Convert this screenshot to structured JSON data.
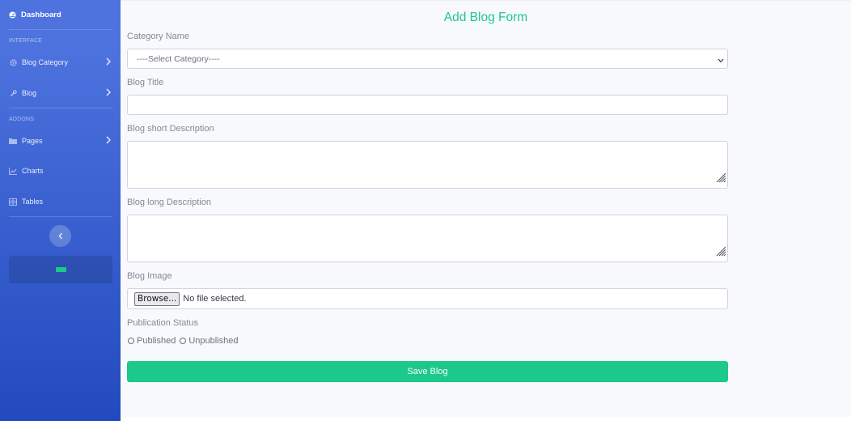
{
  "sidebar": {
    "brand_label": "Dashboard",
    "headings": [
      "INTERFACE",
      "ADDONS"
    ],
    "items": [
      {
        "label": "Blog Category",
        "icon": "gear-icon"
      },
      {
        "label": "Blog",
        "icon": "wrench-icon"
      },
      {
        "label": "Pages",
        "icon": "folder-icon"
      },
      {
        "label": "Charts",
        "icon": "chart-icon"
      },
      {
        "label": "Tables",
        "icon": "table-icon"
      }
    ]
  },
  "form": {
    "title": "Add Blog Form",
    "category_label": "Category Name",
    "category_selected": "----Select Category----",
    "title_label": "Blog Title",
    "title_value": "",
    "short_desc_label": "Blog short Description",
    "short_desc_value": "",
    "long_desc_label": "Blog long Description",
    "long_desc_value": "",
    "image_label": "Blog Image",
    "browse_label": "Browse...",
    "file_status": "No file selected.",
    "status_label": "Publication Status",
    "status_options": [
      "Published",
      "Unpublished"
    ],
    "save_label": "Save Blog"
  },
  "colors": {
    "sidebar_top": "#4e73df",
    "sidebar_bottom": "#224abe",
    "accent_green": "#1cc88a"
  }
}
